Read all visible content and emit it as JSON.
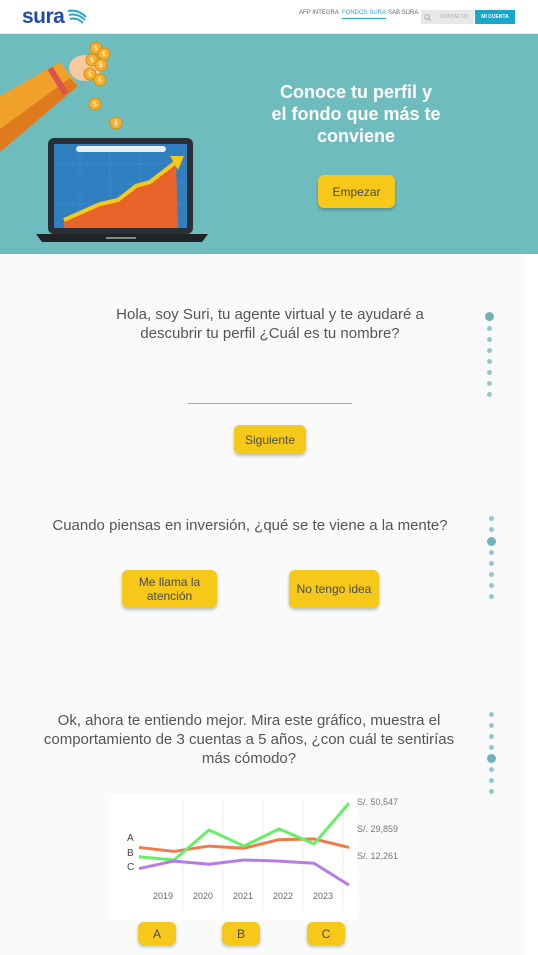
{
  "header": {
    "logo_text": "sura",
    "nav": [
      "AFP INTEGRA",
      "FONDOS SURA",
      "SAB SURA"
    ],
    "search_placeholder": "CONTACTO",
    "account_label": "MI CUENTA",
    "colors": {
      "brand": "#1f4d9e",
      "accent": "#17a8c9"
    }
  },
  "hero": {
    "title": "Conoce tu perfil y el fondo que más te conviene",
    "start_button": "Empezar",
    "background": "#6fbcbf"
  },
  "step1": {
    "question": "Hola, soy Suri, tu agente virtual y te ayudaré a descubrir tu perfil ¿Cuál es tu nombre?",
    "name_value": "",
    "next_button": "Siguiente"
  },
  "step2": {
    "question": "Cuando piensas en inversión, ¿qué se te viene a la mente?",
    "option_a": "Me llama la atención",
    "option_b": "No tengo idea"
  },
  "step3": {
    "question": "Ok, ahora te entiendo mejor. Mira este gráfico, muestra el comportamiento de 3 cuentas a 5 años, ¿con cuál te sentirías más cómodo?",
    "option_a": "A",
    "option_b": "B",
    "option_c": "C"
  },
  "chart_data": {
    "type": "line",
    "x": [
      "2019",
      "2020",
      "2021",
      "2022",
      "2023"
    ],
    "series": [
      {
        "name": "A",
        "color": "#f07a4a",
        "values": [
          29859,
          28000,
          30500,
          29500,
          33500,
          33800,
          29859
        ]
      },
      {
        "name": "B",
        "color": "#66ee66",
        "values": [
          25500,
          24000,
          38000,
          30500,
          38500,
          31500,
          50547
        ]
      },
      {
        "name": "C",
        "color": "#b57be8",
        "values": [
          20000,
          23500,
          22000,
          24000,
          23500,
          22500,
          12261
        ]
      }
    ],
    "end_labels": [
      "S/. 50,547",
      "S/. 29,859",
      "S/. 12,261"
    ],
    "grid": true
  }
}
